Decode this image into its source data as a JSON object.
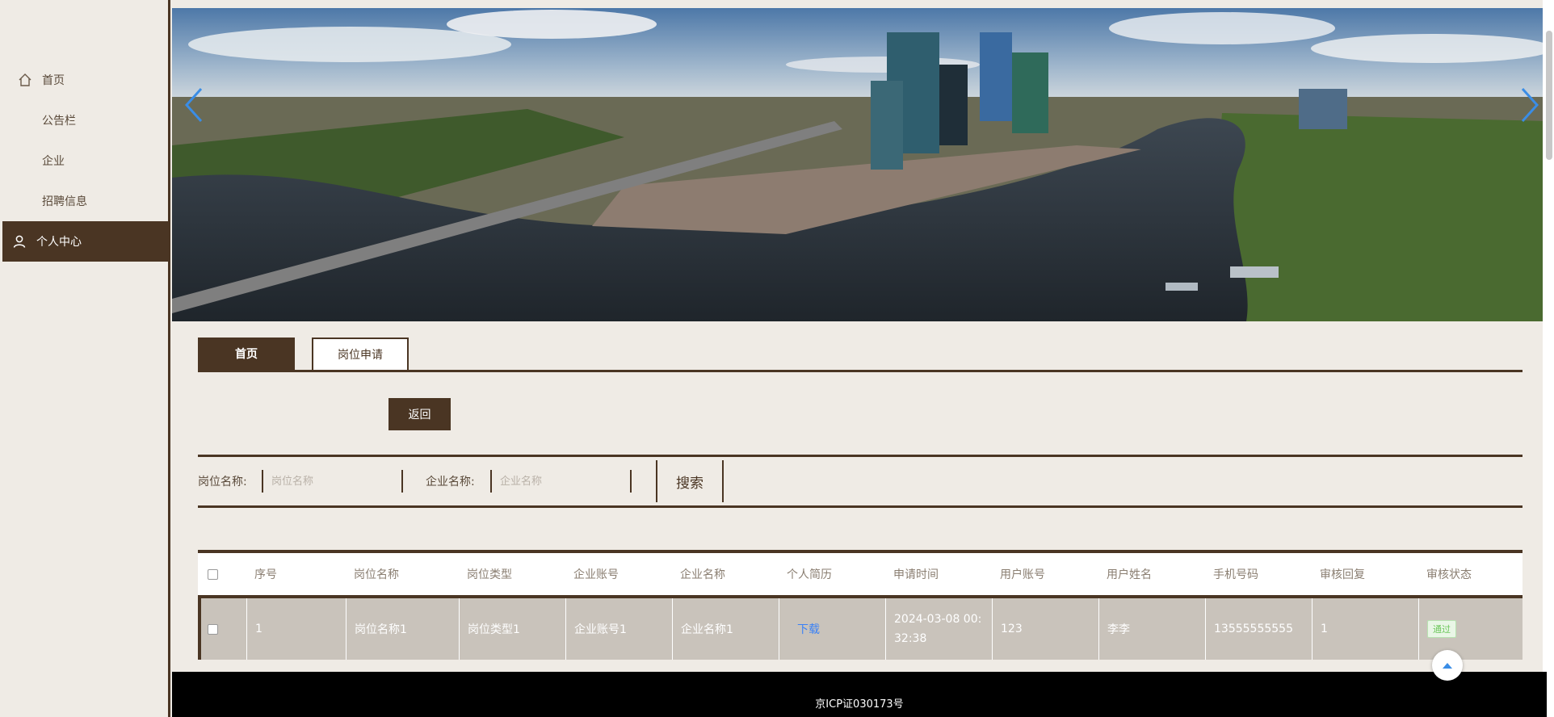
{
  "sidebar": {
    "items": [
      {
        "label": "首页",
        "icon": "home-icon"
      },
      {
        "label": "公告栏"
      },
      {
        "label": "企业"
      },
      {
        "label": "招聘信息"
      },
      {
        "label": "个人中心",
        "icon": "user-icon",
        "active": true
      }
    ]
  },
  "tabs": [
    {
      "label": "首页",
      "active": true
    },
    {
      "label": "岗位申请",
      "active": false
    }
  ],
  "back_button": "返回",
  "search": {
    "position_label": "岗位名称:",
    "position_placeholder": "岗位名称",
    "company_label": "企业名称:",
    "company_placeholder": "企业名称",
    "button": "搜索"
  },
  "table": {
    "columns": [
      "序号",
      "岗位名称",
      "岗位类型",
      "企业账号",
      "企业名称",
      "个人简历",
      "申请时间",
      "用户账号",
      "用户姓名",
      "手机号码",
      "审核回复",
      "审核状态"
    ],
    "rows": [
      {
        "index": "1",
        "position_name": "岗位名称1",
        "position_type": "岗位类型1",
        "company_account": "企业账号1",
        "company_name": "企业名称1",
        "resume": "下载",
        "apply_time": "2024-03-08 00:32:38",
        "user_account": "123",
        "user_name": "李李",
        "phone": "13555555555",
        "review_reply": "1",
        "status": "通过"
      }
    ]
  },
  "footer": {
    "icp": "京ICP证030173号"
  },
  "colors": {
    "brand": "#4a3523",
    "background": "#efebe5",
    "row": "#c9c3bb",
    "link": "#3b82f6",
    "status_green": "#6cc75b"
  }
}
